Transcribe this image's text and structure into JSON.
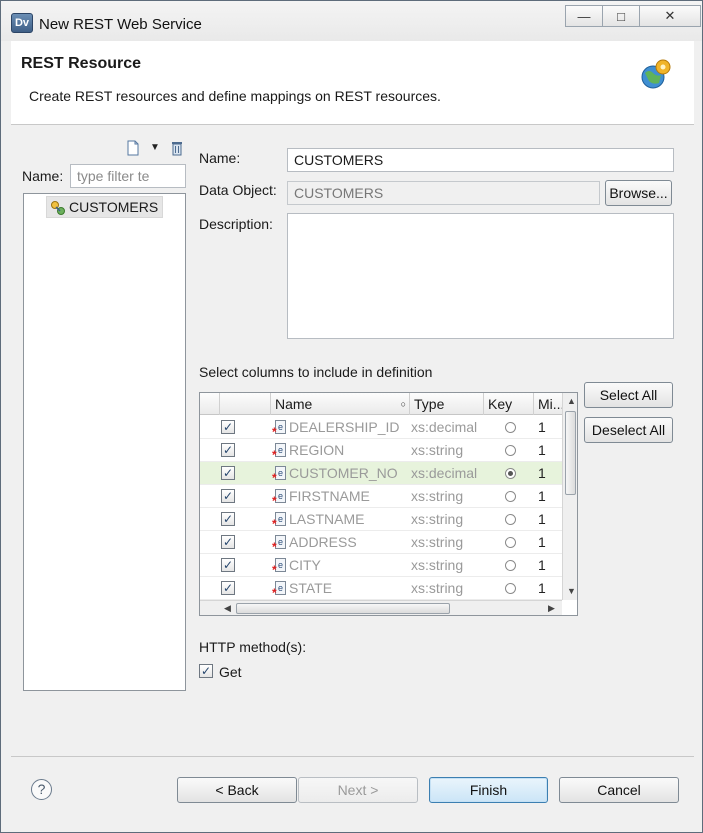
{
  "window": {
    "title": "New REST Web Service",
    "app_icon_text": "Dv",
    "buttons": {
      "minimize": "—",
      "maximize": "□",
      "close": "✕"
    }
  },
  "header": {
    "title": "REST Resource",
    "description": "Create REST resources and define mappings on REST resources."
  },
  "left_panel": {
    "name_label": "Name:",
    "filter_placeholder": "type filter te",
    "tree_items": [
      "CUSTOMERS"
    ]
  },
  "form": {
    "name_label": "Name:",
    "name_value": "CUSTOMERS",
    "data_object_label": "Data Object:",
    "data_object_value": "CUSTOMERS",
    "browse_label": "Browse...",
    "description_label": "Description:",
    "description_value": ""
  },
  "columns": {
    "section_label": "Select columns to include in definition",
    "headers": [
      "Name",
      "Type",
      "Key",
      "Mi..."
    ],
    "select_all_label": "Select All",
    "deselect_all_label": "Deselect All",
    "rows": [
      {
        "name": "DEALERSHIP_ID",
        "type": "xs:decimal",
        "key": false,
        "min": "1",
        "checked": true
      },
      {
        "name": "REGION",
        "type": "xs:string",
        "key": false,
        "min": "1",
        "checked": true
      },
      {
        "name": "CUSTOMER_NO",
        "type": "xs:decimal",
        "key": true,
        "min": "1",
        "checked": true
      },
      {
        "name": "FIRSTNAME",
        "type": "xs:string",
        "key": false,
        "min": "1",
        "checked": true
      },
      {
        "name": "LASTNAME",
        "type": "xs:string",
        "key": false,
        "min": "1",
        "checked": true
      },
      {
        "name": "ADDRESS",
        "type": "xs:string",
        "key": false,
        "min": "1",
        "checked": true
      },
      {
        "name": "CITY",
        "type": "xs:string",
        "key": false,
        "min": "1",
        "checked": true
      },
      {
        "name": "STATE",
        "type": "xs:string",
        "key": false,
        "min": "1",
        "checked": true
      }
    ]
  },
  "http": {
    "label": "HTTP method(s):",
    "get_label": "Get",
    "get_checked": true
  },
  "footer": {
    "help_symbol": "?",
    "back_label": "< Back",
    "next_label": "Next >",
    "finish_label": "Finish",
    "cancel_label": "Cancel"
  },
  "icons": {
    "check": "✓",
    "column_icon": "e",
    "required_marker": "*"
  }
}
